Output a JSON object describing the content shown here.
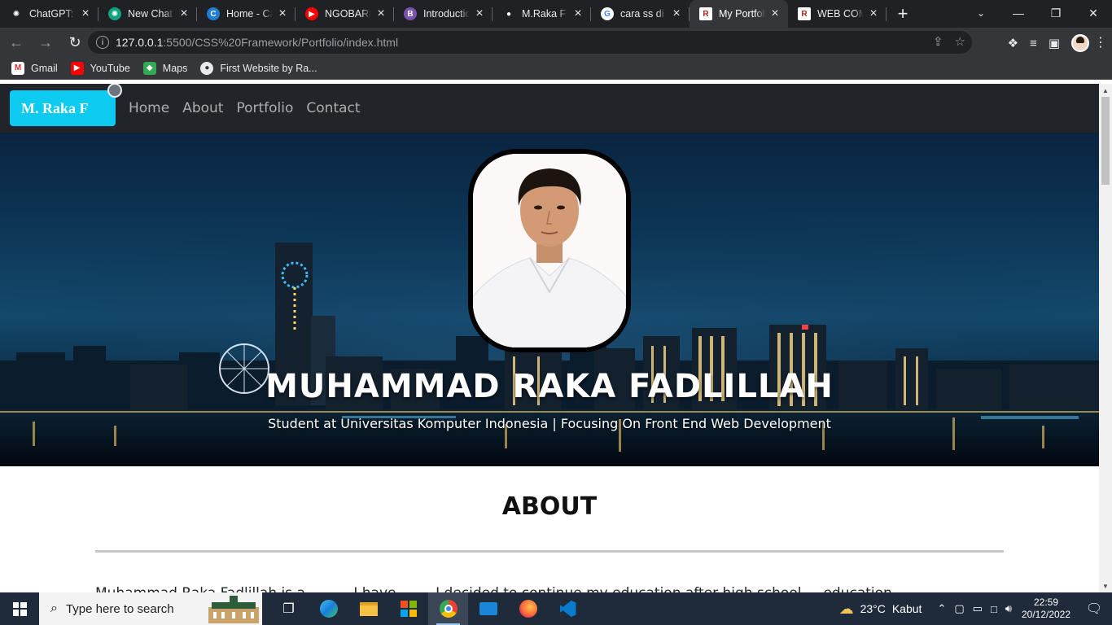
{
  "browser": {
    "tabs": [
      {
        "title": "ChatGPT: Optimizing",
        "icon": "openai-icon",
        "color": "#202124"
      },
      {
        "title": "New Chat",
        "icon": "openai-icon",
        "color": "#10a37f"
      },
      {
        "title": "Home - Canva",
        "icon": "canva-icon",
        "color": "#1f7fd6"
      },
      {
        "title": "NGOBAR#",
        "icon": "youtube-icon",
        "color": "#ff0000"
      },
      {
        "title": "Introduction",
        "icon": "bootstrap-icon",
        "color": "#7952b3"
      },
      {
        "title": "M.Raka F",
        "icon": "globe-icon",
        "color": "#202124"
      },
      {
        "title": "cara ss di laptop",
        "icon": "google-icon",
        "color": "#ffffff"
      },
      {
        "title": "My Portfolio",
        "icon": "r-logo-icon",
        "color": "#ffffff",
        "active": true
      },
      {
        "title": "WEB COMPONENT",
        "icon": "r-logo-icon",
        "color": "#ffffff"
      }
    ],
    "new_tab": "+",
    "url_host": "127.0.0.1",
    "url_path": ":5500/CSS%20Framework/Portfolio/index.html",
    "bookmarks": [
      {
        "label": "Gmail",
        "icon": "gmail-icon"
      },
      {
        "label": "YouTube",
        "icon": "youtube-icon"
      },
      {
        "label": "Maps",
        "icon": "maps-icon"
      },
      {
        "label": "First Website by Ra...",
        "icon": "globe-icon"
      }
    ]
  },
  "site": {
    "brand": "M. Raka F",
    "nav": [
      "Home",
      "About",
      "Portfolio",
      "Contact"
    ],
    "hero_name": "MUHAMMAD RAKA FADLILLAH",
    "hero_subtitle": "Student at Universitas Komputer Indonesia | Focusing On Front End Web Development",
    "about_title": "ABOUT",
    "about_text": "Muhammad Raka Fadlillah is a ......... I have ....... I decided to continue my education after high school ... education"
  },
  "taskbar": {
    "search_placeholder": "Type here to search",
    "apps": [
      "task-view-icon",
      "edge-icon",
      "file-explorer-icon",
      "store-icon",
      "chrome-icon",
      "mail-icon",
      "firefox-icon",
      "vscode-icon"
    ],
    "active_app": "chrome-icon",
    "weather_temp": "23°C",
    "weather_desc": "Kabut",
    "time": "22:59",
    "date": "20/12/2022"
  },
  "colors": {
    "brand_bg": "#0dcaf0",
    "nav_bg": "#212529",
    "taskbar_bg": "#1f2b3a",
    "chrome_dark": "#202124"
  }
}
